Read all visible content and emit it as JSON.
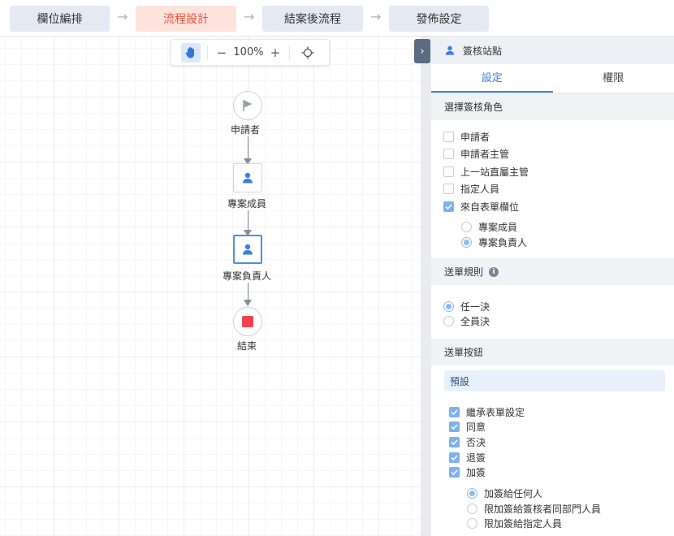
{
  "steps": [
    {
      "label": "欄位編排"
    },
    {
      "label": "流程設計"
    },
    {
      "label": "結案後流程"
    },
    {
      "label": "發佈設定"
    }
  ],
  "step_arrow": "→",
  "toolbar": {
    "zoom_out": "−",
    "zoom": "100%",
    "zoom_in": "+"
  },
  "flow": {
    "applicant": "申請者",
    "member": "專案成員",
    "owner": "專案負責人",
    "end": "結束"
  },
  "panel": {
    "collapse_glyph": "›",
    "title": "簽核站點",
    "tabs": [
      "設定",
      "權限"
    ],
    "role_section": "選擇簽核角色",
    "roles": [
      {
        "label": "申請者",
        "checked": false
      },
      {
        "label": "申請者主管",
        "checked": false
      },
      {
        "label": "上一站直屬主管",
        "checked": false
      },
      {
        "label": "指定人員",
        "checked": false
      },
      {
        "label": "來自表單欄位",
        "checked": true
      }
    ],
    "field_options": [
      {
        "label": "專案成員",
        "checked": false
      },
      {
        "label": "專案負責人",
        "checked": true
      }
    ],
    "rule_section": "送單規則",
    "rule_info": "i",
    "rules": [
      {
        "label": "任一決",
        "checked": true
      },
      {
        "label": "全員決",
        "checked": false
      }
    ],
    "button_section": "送單按鈕",
    "preset": "預設",
    "buttons": [
      {
        "label": "繼承表單設定",
        "checked": true
      },
      {
        "label": "同意",
        "checked": true
      },
      {
        "label": "否決",
        "checked": true
      },
      {
        "label": "退簽",
        "checked": true
      },
      {
        "label": "加簽",
        "checked": true
      }
    ],
    "countersign_options": [
      {
        "label": "加簽給任何人",
        "checked": true
      },
      {
        "label": "限加簽給簽核者同部門人員",
        "checked": false
      },
      {
        "label": "限加簽給指定人員",
        "checked": false
      }
    ]
  },
  "colors": {
    "accent": "#3a7ee0",
    "active_step": "#e8543c",
    "end_node": "#f0434f",
    "node_icon": "#3a7ee0"
  }
}
